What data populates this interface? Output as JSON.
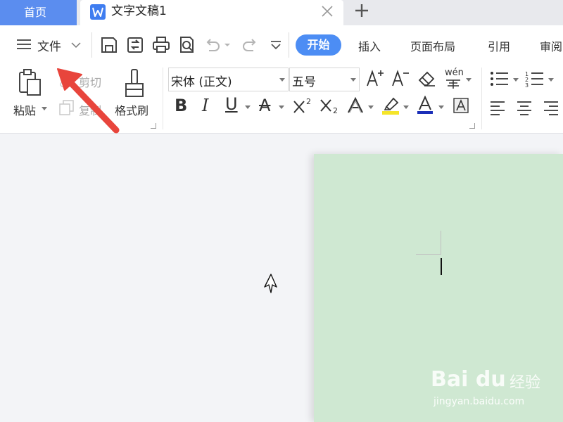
{
  "tabs": {
    "home_label": "首页",
    "doc_title": "文字文稿1"
  },
  "menu": {
    "file_label": "文件",
    "active_tab": "开始",
    "tabs": [
      "插入",
      "页面布局",
      "引用",
      "审阅"
    ]
  },
  "ribbon": {
    "paste_label": "粘贴",
    "cut_label": "剪切",
    "copy_label": "复制",
    "format_painter_label": "格式刷",
    "font_name": "宋体 (正文)",
    "font_size": "五号",
    "phonetic_label": "wén"
  },
  "watermark": {
    "logo": "Bai du",
    "brand": "经验",
    "url": "jingyan.baidu.com"
  },
  "colors": {
    "accent": "#4c8df4",
    "home_tab": "#5b8def",
    "page_bg": "#cfe8d2",
    "annotation_arrow": "#e8453c",
    "highlight": "#f5e52a",
    "font_color": "#1b2fb8"
  },
  "icons": {
    "doc": "wps-writer-icon",
    "close": "close-icon",
    "add": "plus-icon",
    "menu": "hamburger-icon",
    "save": "save-icon",
    "export": "export-icon",
    "print": "print-icon",
    "preview": "print-preview-icon",
    "undo": "undo-icon",
    "redo": "redo-icon",
    "more": "more-icon"
  }
}
